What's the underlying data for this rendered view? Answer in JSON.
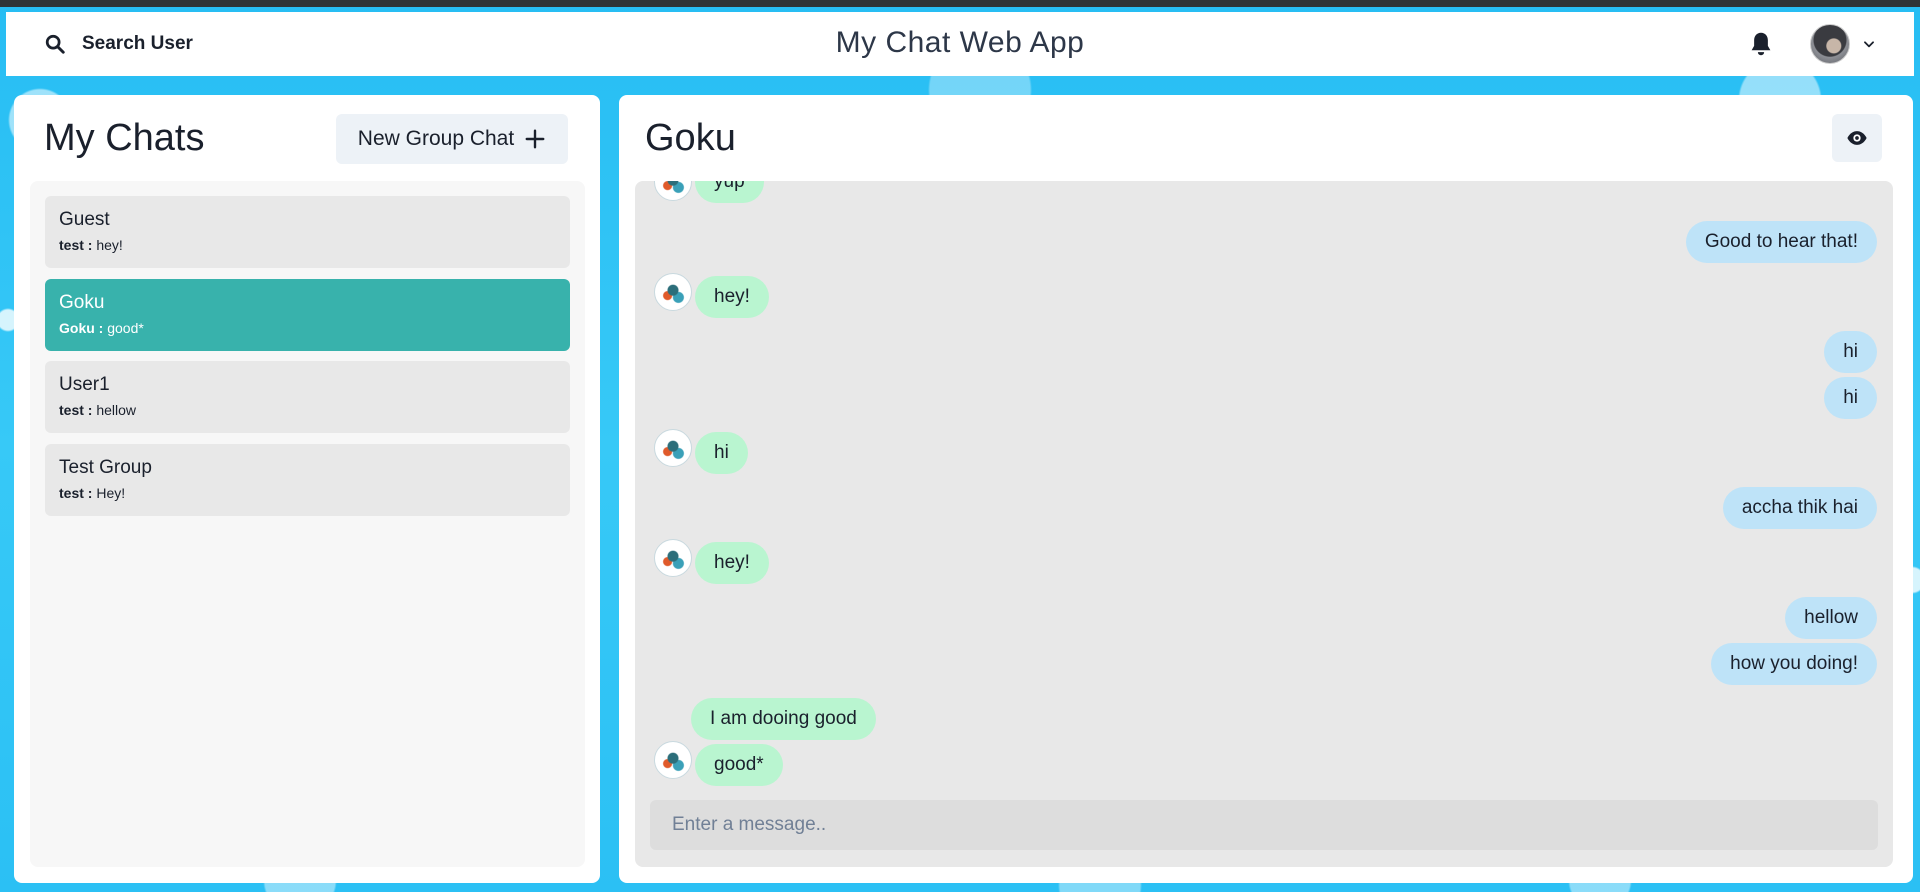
{
  "navbar": {
    "search_label": "Search User",
    "app_title": "My Chat Web App"
  },
  "left": {
    "title": "My Chats",
    "new_group_label": "New Group Chat",
    "chats": [
      {
        "name": "Guest",
        "sender": "test :",
        "message": "hey!",
        "active": false
      },
      {
        "name": "Goku",
        "sender": "Goku :",
        "message": "good*",
        "active": true
      },
      {
        "name": "User1",
        "sender": "test :",
        "message": "hellow",
        "active": false
      },
      {
        "name": "Test Group",
        "sender": "test :",
        "message": "Hey!",
        "active": false
      }
    ]
  },
  "right": {
    "chat_title": "Goku",
    "messages": [
      {
        "text": "yup",
        "side": "recv"
      },
      {
        "text": "Good to hear that!",
        "side": "sent"
      },
      {
        "text": "hey!",
        "side": "recv"
      },
      {
        "text": "hi",
        "side": "sent"
      },
      {
        "text": "hi",
        "side": "sent"
      },
      {
        "text": "hi",
        "side": "recv"
      },
      {
        "text": "accha thik hai",
        "side": "sent"
      },
      {
        "text": "hey!",
        "side": "recv"
      },
      {
        "text": "hellow",
        "side": "sent"
      },
      {
        "text": "how you doing!",
        "side": "sent"
      },
      {
        "text": "I am dooing good",
        "side": "recv"
      },
      {
        "text": "good*",
        "side": "recv"
      }
    ],
    "composer_placeholder": "Enter a message.."
  },
  "colors": {
    "active_chat": "#38b2ac",
    "sent_bubble": "#bee3f8",
    "received_bubble": "#b9f5d0",
    "background": "#2ec4f5"
  },
  "icons": [
    "search-icon",
    "bell-icon",
    "chevron-down-icon",
    "plus-icon",
    "eye-icon"
  ]
}
